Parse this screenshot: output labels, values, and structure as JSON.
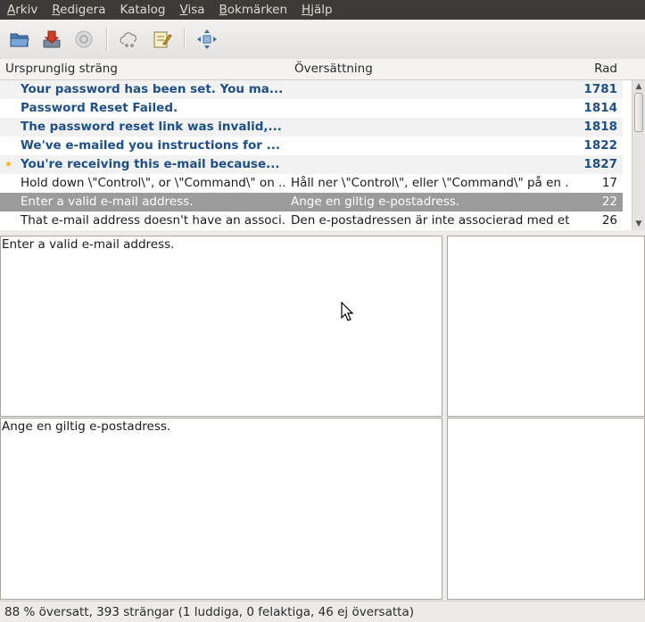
{
  "menubar": {
    "items": [
      {
        "first": "A",
        "rest": "rkiv"
      },
      {
        "first": "R",
        "rest": "edigera"
      },
      {
        "first": "",
        "rest": "Katalog"
      },
      {
        "first": "V",
        "rest": "isa"
      },
      {
        "first": "B",
        "rest": "okmärken"
      },
      {
        "first": "H",
        "rest": "jälp"
      }
    ]
  },
  "toolbar": {
    "icons": [
      "folder-open-icon",
      "download-save-icon",
      "update-icon",
      "cloud-icon",
      "edit-notes-icon",
      "fit-arrows-icon"
    ]
  },
  "columns": {
    "source": "Ursprunglig sträng",
    "translation": "Översättning",
    "line": "Rad"
  },
  "rows": [
    {
      "source": "Your password has been set. You ma...",
      "translation": "",
      "line": "1781",
      "state": "untranslated"
    },
    {
      "source": "Password Reset Failed.",
      "translation": "",
      "line": "1814",
      "state": "untranslated"
    },
    {
      "source": "The password reset link was invalid,...",
      "translation": "",
      "line": "1818",
      "state": "untranslated"
    },
    {
      "source": "We've e-mailed you instructions for ...",
      "translation": "",
      "line": "1822",
      "state": "untranslated"
    },
    {
      "source": "You're receiving this e-mail because...",
      "translation": "",
      "line": "1827",
      "state": "untranslated",
      "star": "★"
    },
    {
      "source": "Hold down \\\"Control\\\", or \\\"Command\\\" on ...",
      "translation": "Håll ner \\\"Control\\\", eller \\\"Command\\\" på en ...",
      "line": "17",
      "state": "translated"
    },
    {
      "source": "Enter a valid e-mail address.",
      "translation": "Ange en giltig e-postadress.",
      "line": "22",
      "state": "selected"
    },
    {
      "source": "That e-mail address doesn't have an associ...",
      "translation": "Den e-postadressen är inte associerad med et...",
      "line": "26",
      "state": "translated"
    }
  ],
  "source_pane": {
    "text": "Enter a valid e-mail address."
  },
  "translation_pane": {
    "text": "Ange en giltig e-postadress."
  },
  "status": {
    "text": "88 % översatt, 393 strängar (1 luddiga, 0 felaktiga, 46 ej översatta)"
  },
  "colors": {
    "untranslated": "#1e4f86",
    "selected_row": "#9b9b9b",
    "menubar": "#3c3b37"
  }
}
